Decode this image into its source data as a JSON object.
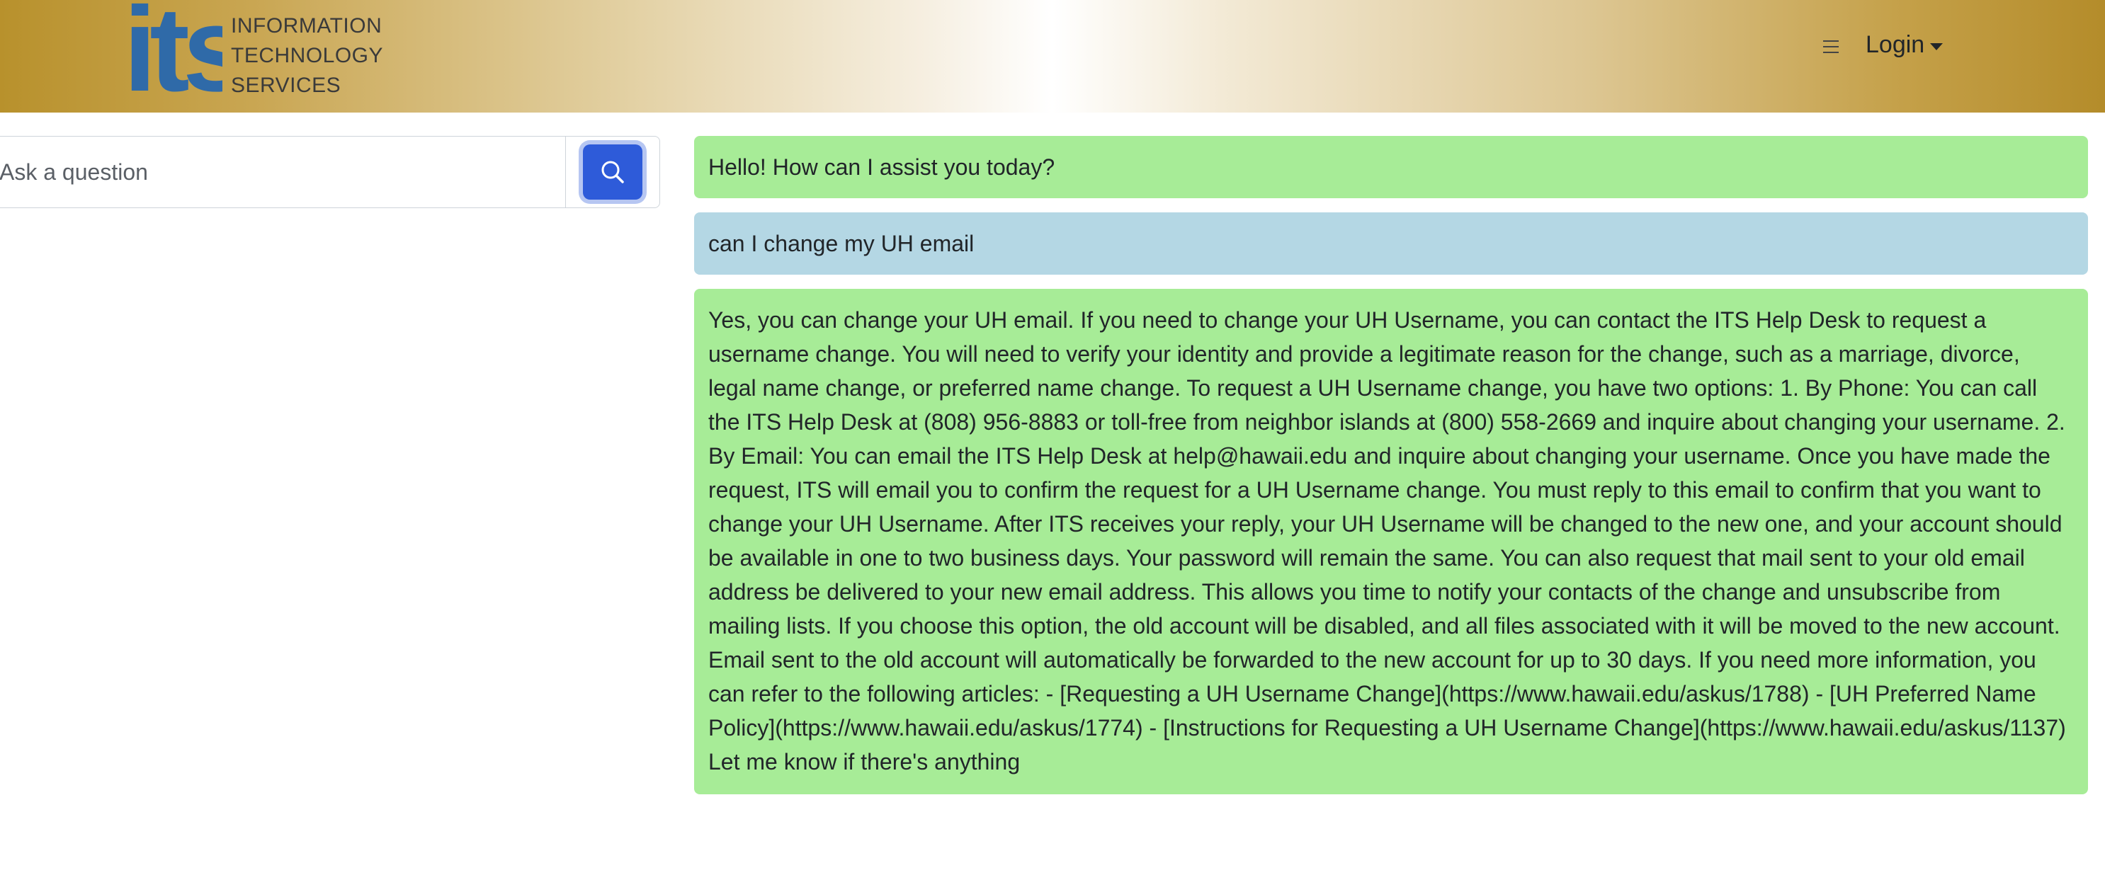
{
  "header": {
    "logo_mark": "its",
    "logo_lines": [
      "INFORMATION",
      "TECHNOLOGY",
      "SERVICES"
    ],
    "menu_icon": "hamburger-icon",
    "login_label": "Login",
    "colors": {
      "gold": "#b8912c",
      "center": "#ffffff",
      "logo_blue": "#2f6aa8"
    }
  },
  "search": {
    "placeholder": "Ask a question",
    "value": "",
    "button_icon": "search-icon",
    "button_color": "#2e5bd9"
  },
  "messages": [
    {
      "role": "bot",
      "color": "#a7ec97",
      "text": "Hello! How can I assist you today?"
    },
    {
      "role": "user",
      "color": "#b4d7e4",
      "text": "can I change my UH email"
    },
    {
      "role": "bot",
      "color": "#a7ec97",
      "text": "Yes, you can change your UH email. If you need to change your UH Username, you can contact the ITS Help Desk to request a username change. You will need to verify your identity and provide a legitimate reason for the change, such as a marriage, divorce, legal name change, or preferred name change. To request a UH Username change, you have two options: 1. By Phone: You can call the ITS Help Desk at (808) 956-8883 or toll-free from neighbor islands at (800) 558-2669 and inquire about changing your username. 2. By Email: You can email the ITS Help Desk at help@hawaii.edu and inquire about changing your username. Once you have made the request, ITS will email you to confirm the request for a UH Username change. You must reply to this email to confirm that you want to change your UH Username. After ITS receives your reply, your UH Username will be changed to the new one, and your account should be available in one to two business days. Your password will remain the same. You can also request that mail sent to your old email address be delivered to your new email address. This allows you time to notify your contacts of the change and unsubscribe from mailing lists. If you choose this option, the old account will be disabled, and all files associated with it will be moved to the new account. Email sent to the old account will automatically be forwarded to the new account for up to 30 days. If you need more information, you can refer to the following articles: - [Requesting a UH Username Change](https://www.hawaii.edu/askus/1788) - [UH Preferred Name Policy](https://www.hawaii.edu/askus/1774) - [Instructions for Requesting a UH Username Change](https://www.hawaii.edu/askus/1137) Let me know if there's anything"
    }
  ]
}
